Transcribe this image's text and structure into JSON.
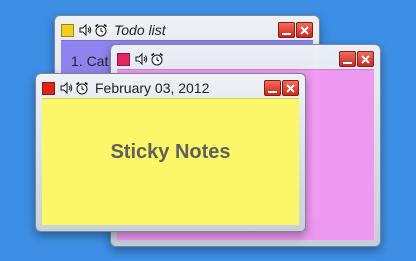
{
  "colors": {
    "desktop_background": "#3d8fe6",
    "todo_note": "#8f84ef",
    "pink_note": "#f29af2",
    "yellow_note": "#fbf769",
    "todo_swatch": "#f2cf1d",
    "pink_swatch": "#e4245e",
    "yellow_swatch": "#e22219",
    "close_button": "#d2271a"
  },
  "icons": {
    "speaker": "speaker-icon",
    "alarm": "alarm-clock-icon",
    "minimize": "minimize-icon",
    "close": "close-icon"
  },
  "notes": {
    "todo": {
      "title": "Todo list",
      "body_first_line": "1. Cat"
    },
    "pink": {
      "title": ""
    },
    "yellow": {
      "title": "February 03, 2012",
      "body": "Sticky Notes"
    }
  }
}
